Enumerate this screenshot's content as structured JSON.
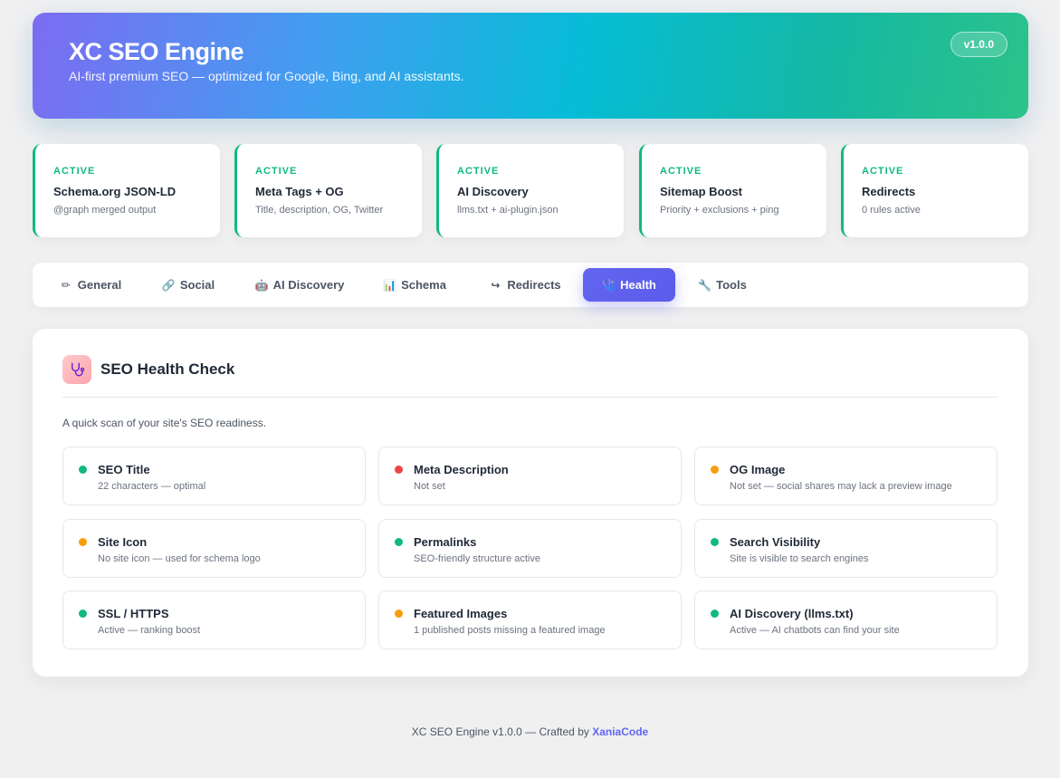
{
  "header": {
    "title": "XC SEO Engine",
    "subtitle": "AI-first premium SEO — optimized for Google, Bing, and AI assistants.",
    "version": "v1.0.0"
  },
  "features": [
    {
      "status": "ACTIVE",
      "title": "Schema.org JSON-LD",
      "desc": "@graph merged output"
    },
    {
      "status": "ACTIVE",
      "title": "Meta Tags + OG",
      "desc": "Title, description, OG, Twitter"
    },
    {
      "status": "ACTIVE",
      "title": "AI Discovery",
      "desc": "llms.txt + ai-plugin.json"
    },
    {
      "status": "ACTIVE",
      "title": "Sitemap Boost",
      "desc": "Priority + exclusions + ping"
    },
    {
      "status": "ACTIVE",
      "title": "Redirects",
      "desc": "0 rules active"
    }
  ],
  "tabs": [
    {
      "icon": "✏",
      "icon_name": "memo-icon",
      "label": "General",
      "active": false
    },
    {
      "icon": "🔗",
      "icon_name": "link-icon",
      "label": "Social",
      "active": false
    },
    {
      "icon": "🤖",
      "icon_name": "robot-icon",
      "label": "AI Discovery",
      "active": false
    },
    {
      "icon": "📊",
      "icon_name": "chart-icon",
      "label": "Schema",
      "active": false
    },
    {
      "icon": "↪",
      "icon_name": "redirect-arrow-icon",
      "label": "Redirects",
      "active": false
    },
    {
      "icon": "🩺",
      "icon_name": "stethoscope-icon",
      "label": "Health",
      "active": true
    },
    {
      "icon": "🔧",
      "icon_name": "wrench-icon",
      "label": "Tools",
      "active": false
    }
  ],
  "health": {
    "title": "SEO Health Check",
    "icon_name": "stethoscope-icon",
    "intro": "A quick scan of your site's SEO readiness.",
    "checks": [
      {
        "status": "good",
        "title": "SEO Title",
        "desc": "22 characters — optimal"
      },
      {
        "status": "bad",
        "title": "Meta Description",
        "desc": "Not set"
      },
      {
        "status": "warn",
        "title": "OG Image",
        "desc": "Not set — social shares may lack a preview image"
      },
      {
        "status": "warn",
        "title": "Site Icon",
        "desc": "No site icon — used for schema logo"
      },
      {
        "status": "good",
        "title": "Permalinks",
        "desc": "SEO-friendly structure active"
      },
      {
        "status": "good",
        "title": "Search Visibility",
        "desc": "Site is visible to search engines"
      },
      {
        "status": "good",
        "title": "SSL / HTTPS",
        "desc": "Active — ranking boost"
      },
      {
        "status": "warn",
        "title": "Featured Images",
        "desc": "1 published posts missing a featured image"
      },
      {
        "status": "good",
        "title": "AI Discovery (llms.txt)",
        "desc": "Active — AI chatbots can find your site"
      }
    ]
  },
  "colors": {
    "good": "#10b981",
    "bad": "#ef4444",
    "warn": "#f59e0b",
    "accent": "#6366f1"
  },
  "footer": {
    "text": "XC SEO Engine v1.0.0 — Crafted by ",
    "link": "XaniaCode"
  }
}
